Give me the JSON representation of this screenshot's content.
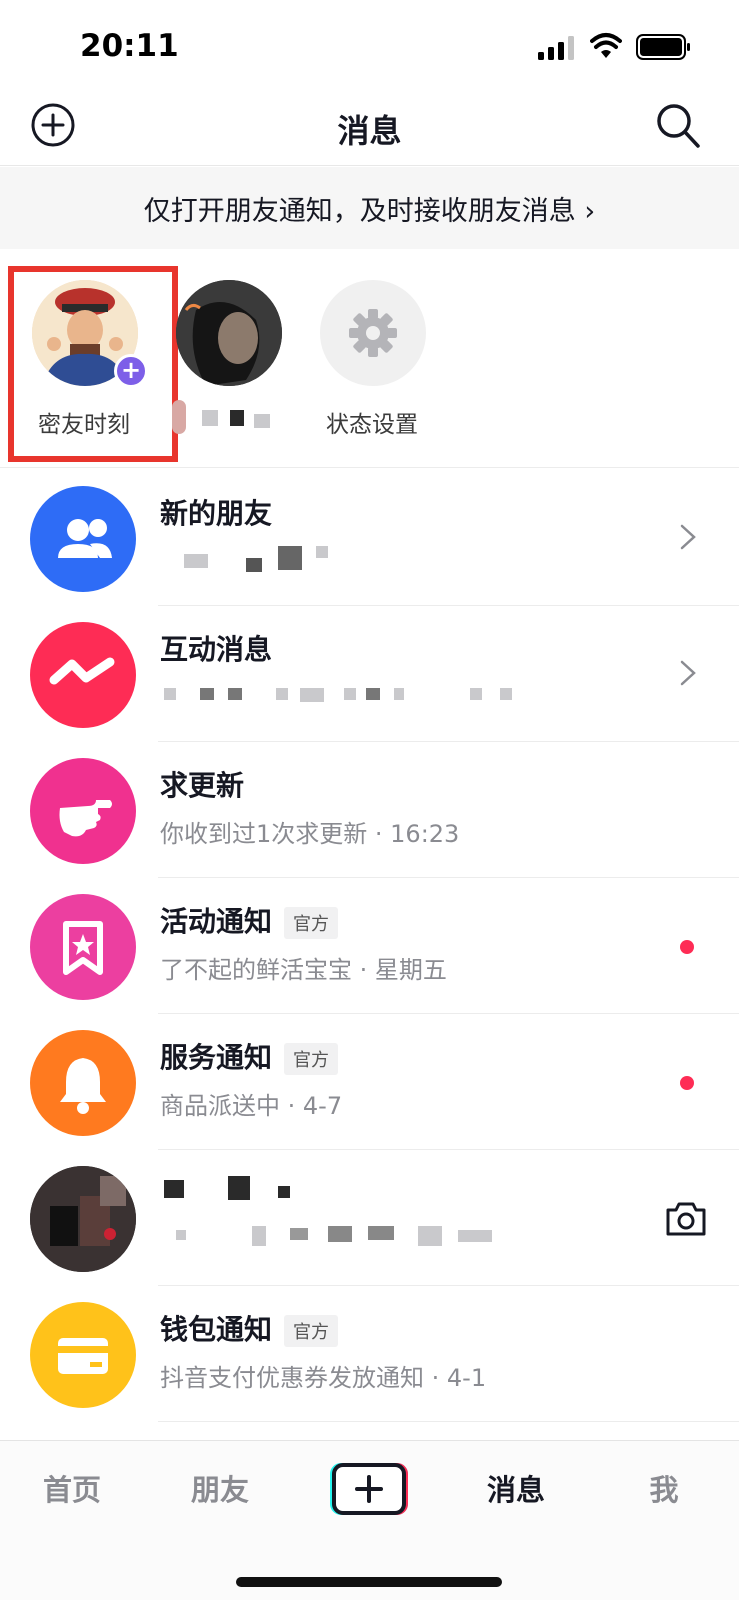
{
  "status_bar": {
    "time": "20:11"
  },
  "header": {
    "title": "消息"
  },
  "banner": {
    "text": "仅打开朋友通知，及时接收朋友消息 ›"
  },
  "stories": [
    {
      "label": "密友时刻"
    },
    {
      "label": ""
    },
    {
      "label": "状态设置"
    }
  ],
  "messages": [
    {
      "title": "新的朋友",
      "subtitle": "",
      "color": "#2e6cf6",
      "icon": "friends-icon"
    },
    {
      "title": "互动消息",
      "subtitle": "",
      "color": "#fe2c55",
      "icon": "interaction-icon"
    },
    {
      "title": "求更新",
      "subtitle": "你收到过1次求更新 · 16:23",
      "color": "#f0318f",
      "icon": "pointing-hand-icon"
    },
    {
      "title": "活动通知",
      "tag": "官方",
      "subtitle": "了不起的鲜活宝宝 · 星期五",
      "color": "#ec3fa0",
      "icon": "bookmark-star-icon"
    },
    {
      "title": "服务通知",
      "tag": "官方",
      "subtitle": "商品派送中 · 4-7",
      "color": "#ff7a1f",
      "icon": "bell-icon"
    },
    {
      "title": "",
      "subtitle": "",
      "icon": "camera-icon"
    },
    {
      "title": "钱包通知",
      "tag": "官方",
      "subtitle": "抖音支付优惠券发放通知 · 4-1",
      "color": "#ffc21a",
      "icon": "wallet-icon"
    }
  ],
  "tab_bar": {
    "home": "首页",
    "friends": "朋友",
    "messages": "消息",
    "me": "我"
  },
  "colors": {
    "accent": "#fe2c55",
    "highlight_border": "#e8352d",
    "badge": "#7d5fe8"
  }
}
